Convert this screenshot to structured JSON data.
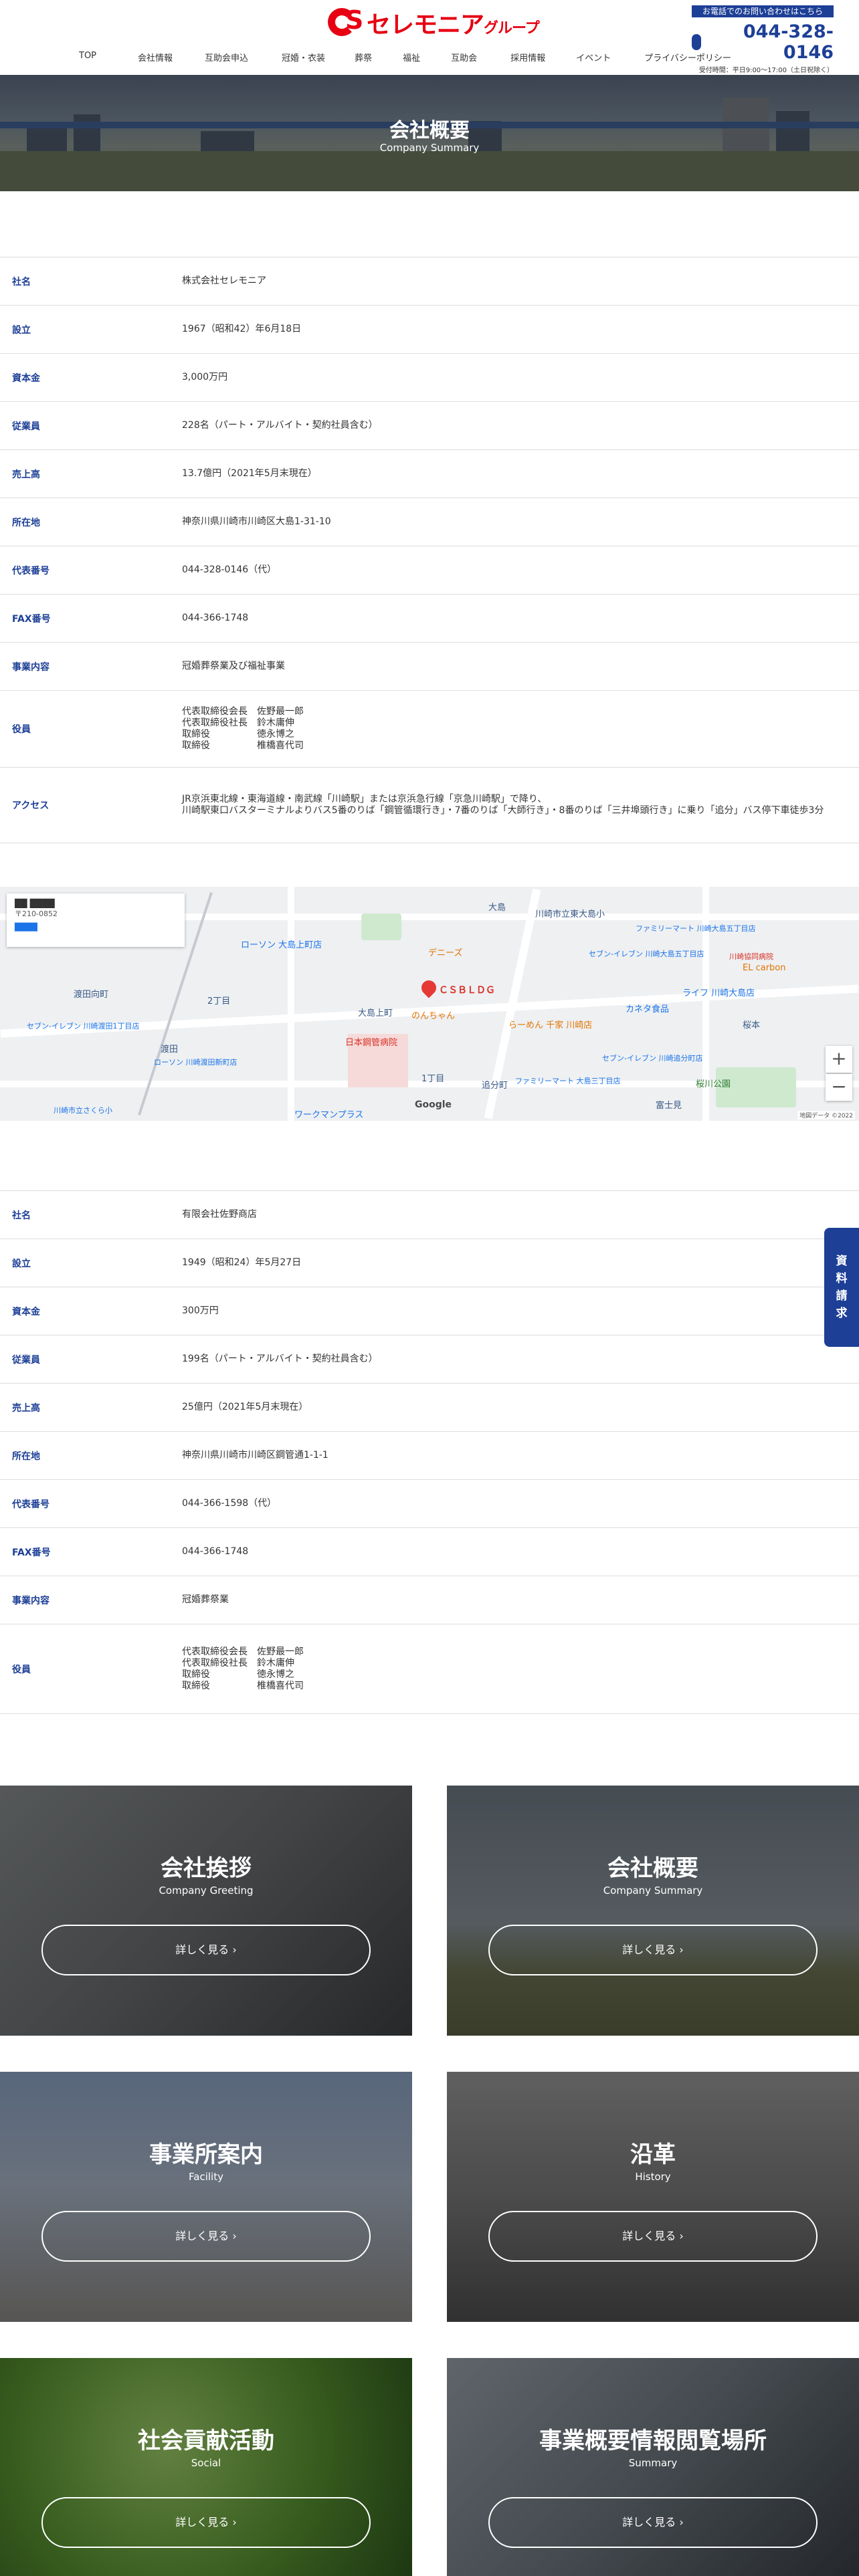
{
  "header": {
    "logo_text": "セレモニア",
    "logo_suffix": "グループ",
    "contact_band": "お電話でのお問い合わせはこちら",
    "phone": "044-328-0146",
    "hours": "受付時間：平日9:00〜17:00（土日祝除く）"
  },
  "nav": [
    "TOP",
    "会社情報",
    "互助会申込",
    "冠婚・衣装",
    "葬祭",
    "福祉",
    "互助会",
    "採用情報",
    "イベント",
    "プライバシーポリシー"
  ],
  "hero": {
    "title": "会社概要",
    "subtitle": "Company Summary"
  },
  "company1": [
    {
      "label": "社名",
      "value": "株式会社セレモニア"
    },
    {
      "label": "設立",
      "value": "1967（昭和42）年6月18日"
    },
    {
      "label": "資本金",
      "value": "3,000万円"
    },
    {
      "label": "従業員",
      "value": "228名（パート・アルバイト・契約社員含む）"
    },
    {
      "label": "売上高",
      "value": "13.7億円（2021年5月末現在）"
    },
    {
      "label": "所在地",
      "value": "神奈川県川崎市川崎区大島1-31-10"
    },
    {
      "label": "代表番号",
      "value": "044-328-0146（代）"
    },
    {
      "label": "FAX番号",
      "value": "044-366-1748"
    },
    {
      "label": "事業内容",
      "value": "冠婚葬祭業及び福祉事業"
    },
    {
      "label": "役員",
      "value": "代表取締役会長　佐野最一郎\n代表取締役社長　鈴木庸伸\n取締役　　　　　徳永博之\n取締役　　　　　椎橋喜代司"
    },
    {
      "label": "アクセス",
      "value": "JR京浜東北線・東海道線・南武線「川崎駅」または京浜急行線「京急川崎駅」で降り、\n川崎駅東口バスターミナルよりバス5番のりば「鋼管循環行き」・7番のりば「大師行き」・8番のりば「三井埠頭行き」に乗り「追分」バス停下車徒歩3分"
    }
  ],
  "map": {
    "card_title": "〒210-0852",
    "labels": [
      "大島",
      "川崎市立東大島小",
      "ローソン 大島上町店",
      "デニーズ",
      "ファミリーマート 川崎大島五丁目店",
      "セブン-イレブン 川崎大島五丁目店",
      "川崎協同病院",
      "EL carbon",
      "渡田向町",
      "2丁目",
      "大島上町",
      "のんちゃん",
      "ライフ 川崎大島店",
      "カネタ食品",
      "桜本",
      "日本鋼管病院",
      "らーめん 千家 川崎店",
      "セブン-イレブン 川崎渡田1丁目店",
      "渡田",
      "ローソン 川崎渡田新町店",
      "1丁目",
      "セブン-イレブン 川崎追分町店",
      "ファミリーマート 大島三丁目店",
      "桜川公園",
      "追分町",
      "ワークマンプラス",
      "富士見",
      "川崎市立さくら小"
    ],
    "pin_label": "ＣＳＢＬＤＧ",
    "google": "Google",
    "footer": "地図データ ©2022"
  },
  "company2": [
    {
      "label": "社名",
      "value": "有限会社佐野商店"
    },
    {
      "label": "設立",
      "value": "1949（昭和24）年5月27日"
    },
    {
      "label": "資本金",
      "value": "300万円"
    },
    {
      "label": "従業員",
      "value": "199名（パート・アルバイト・契約社員含む）"
    },
    {
      "label": "売上高",
      "value": "25億円（2021年5月末現在）"
    },
    {
      "label": "所在地",
      "value": "神奈川県川崎市川崎区鋼管通1-1-1"
    },
    {
      "label": "代表番号",
      "value": "044-366-1598（代）"
    },
    {
      "label": "FAX番号",
      "value": "044-366-1748"
    },
    {
      "label": "事業内容",
      "value": "冠婚葬祭業"
    },
    {
      "label": "役員",
      "value": "代表取締役会長　佐野最一郎\n代表取締役社長　鈴木庸伸\n取締役　　　　　徳永博之\n取締役　　　　　椎橋喜代司"
    }
  ],
  "side_tab": [
    "資",
    "料",
    "請",
    "求"
  ],
  "cards": [
    {
      "title": "会社挨拶",
      "subtitle": "Company Greeting",
      "button": "詳しく見る ›"
    },
    {
      "title": "会社概要",
      "subtitle": "Company Summary",
      "button": "詳しく見る ›"
    },
    {
      "title": "事業所案内",
      "subtitle": "Facility",
      "button": "詳しく見る ›"
    },
    {
      "title": "沿革",
      "subtitle": "History",
      "button": "詳しく見る ›"
    },
    {
      "title": "社会貢献活動",
      "subtitle": "Social",
      "button": "詳しく見る ›"
    },
    {
      "title": "事業概要情報閲覧場所",
      "subtitle": "Summary",
      "button": "詳しく見る ›"
    }
  ]
}
